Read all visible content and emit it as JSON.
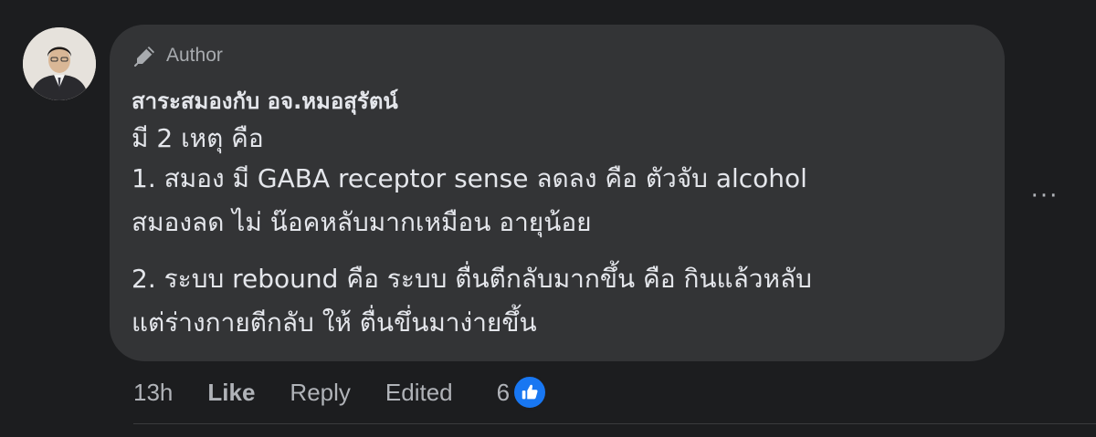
{
  "comment": {
    "author_badge": "Author",
    "author_name": "สาระสมองกับ อจ.หมอสุรัตน์",
    "lines": [
      "มี 2 เหตุ คือ",
      "1. สมอง มี GABA receptor sense ลดลง คือ ตัวจับ alcohol",
      "สมองลด ไม่ น๊อคหลับมากเหมือน อายุน้อย",
      "2. ระบบ rebound คือ ระบบ ตื่นตีกลับมากขึ้น คือ กินแล้วหลับ",
      "แต่ร่างกายตีกลับ ให้ ตื่นขึ่นมาง่ายขึ้น"
    ]
  },
  "actions": {
    "time": "13h",
    "like_label": "Like",
    "reply_label": "Reply",
    "edited_label": "Edited",
    "reaction_count": "6"
  },
  "icons": {
    "author_badge_icon": "pen-icon",
    "more_icon": "more-options-icon",
    "reaction_icon": "thumbs-up-icon"
  },
  "colors": {
    "background": "#1c1d1f",
    "bubble": "#333436",
    "text": "#e4e6eb",
    "muted": "#b0b3b8",
    "like_blue": "#1877f2"
  },
  "more_glyph": "···"
}
